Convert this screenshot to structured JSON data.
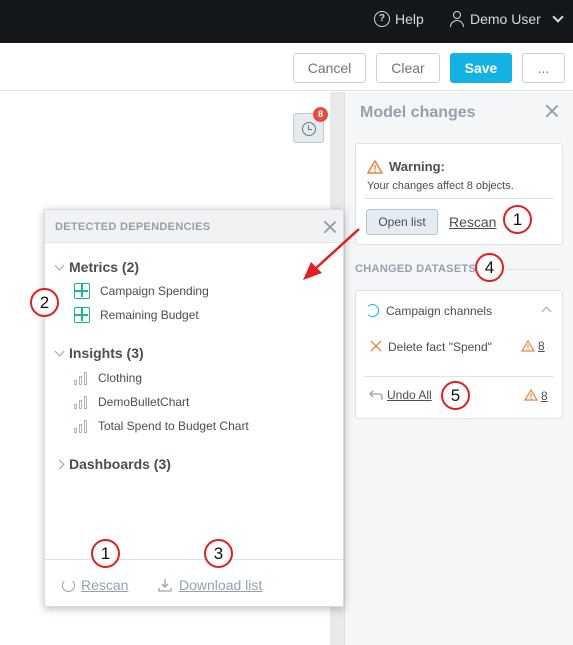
{
  "topbar": {
    "help_label": "Help",
    "user_label": "Demo User"
  },
  "toolbar": {
    "cancel_label": "Cancel",
    "clear_label": "Clear",
    "save_label": "Save",
    "more_label": "..."
  },
  "history": {
    "badge_count": "8"
  },
  "model_changes": {
    "title": "Model changes",
    "warning_title": "Warning:",
    "warning_text": "Your changes affect 8 objects.",
    "open_list_label": "Open list",
    "rescan_label": "Rescan",
    "changed_datasets_label": "CHANGED DATASETS",
    "dataset_name": "Campaign channels",
    "change_label": "Delete fact \"Spend\"",
    "change_count": "8",
    "undo_label": "Undo All",
    "undo_count": "8"
  },
  "dependencies": {
    "title": "DETECTED DEPENDENCIES",
    "groups": [
      {
        "label": "Metrics (2)",
        "items": [
          "Campaign Spending",
          "Remaining Budget"
        ]
      },
      {
        "label": "Insights (3)",
        "items": [
          "Clothing",
          "DemoBulletChart",
          "Total Spend to Budget Chart"
        ]
      },
      {
        "label": "Dashboards (3)",
        "items": []
      }
    ],
    "rescan_label": "Rescan",
    "download_label": "Download list"
  },
  "callouts": [
    "1",
    "2",
    "1",
    "3",
    "4",
    "5"
  ],
  "colors": {
    "accent": "#14b2e2",
    "warning": "#e8853d",
    "callout": "#e02020",
    "metric": "#17b890"
  }
}
